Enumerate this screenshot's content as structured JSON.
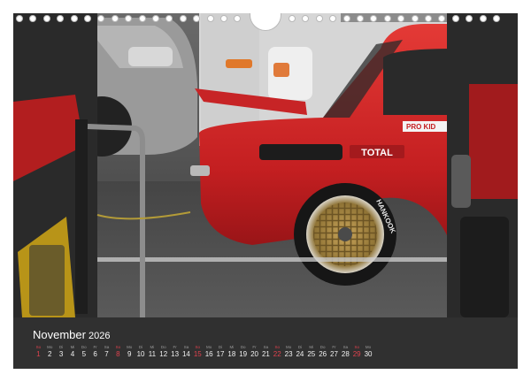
{
  "calendar": {
    "month": "November",
    "year": "2026",
    "days": [
      {
        "name": "So",
        "num": "1"
      },
      {
        "name": "Mo",
        "num": "2"
      },
      {
        "name": "Di",
        "num": "3"
      },
      {
        "name": "Mi",
        "num": "4"
      },
      {
        "name": "Do",
        "num": "5"
      },
      {
        "name": "Fr",
        "num": "6"
      },
      {
        "name": "Sa",
        "num": "7"
      },
      {
        "name": "So",
        "num": "8"
      },
      {
        "name": "Mo",
        "num": "9"
      },
      {
        "name": "Di",
        "num": "10"
      },
      {
        "name": "Mi",
        "num": "11"
      },
      {
        "name": "Do",
        "num": "12"
      },
      {
        "name": "Fr",
        "num": "13"
      },
      {
        "name": "Sa",
        "num": "14"
      },
      {
        "name": "So",
        "num": "15"
      },
      {
        "name": "Mo",
        "num": "16"
      },
      {
        "name": "Di",
        "num": "17"
      },
      {
        "name": "Mi",
        "num": "18"
      },
      {
        "name": "Do",
        "num": "19"
      },
      {
        "name": "Fr",
        "num": "20"
      },
      {
        "name": "Sa",
        "num": "21"
      },
      {
        "name": "So",
        "num": "22"
      },
      {
        "name": "Mo",
        "num": "23"
      },
      {
        "name": "Di",
        "num": "24"
      },
      {
        "name": "Mi",
        "num": "25"
      },
      {
        "name": "Do",
        "num": "26"
      },
      {
        "name": "Fr",
        "num": "27"
      },
      {
        "name": "Sa",
        "num": "28"
      },
      {
        "name": "So",
        "num": "29"
      },
      {
        "name": "Mo",
        "num": "30"
      }
    ],
    "sunday_color": "#e0424e"
  },
  "photo": {
    "car_logo": "TOTAL",
    "sticker": "PRO KID",
    "wheel_brand": "HANKOOK"
  }
}
